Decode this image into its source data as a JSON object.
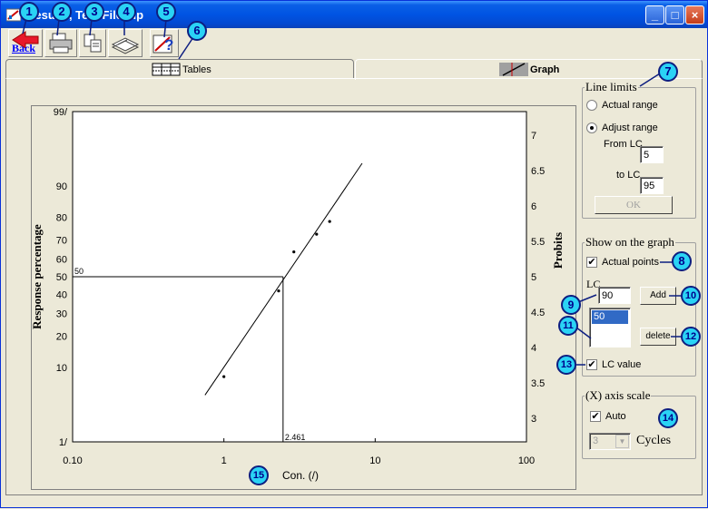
{
  "window": {
    "title": "Results, Test File.ldp",
    "minimize": "_",
    "maximize": "□",
    "close": "×"
  },
  "toolbar": {
    "back_label": "Back"
  },
  "tabs": [
    {
      "label": "Tables",
      "selected": false
    },
    {
      "label": "Graph",
      "selected": true
    }
  ],
  "callouts": {
    "m1": "1",
    "m2": "2",
    "m3": "3",
    "m4": "4",
    "m5": "5",
    "m6": "6",
    "m7": "7",
    "m8": "8",
    "m9": "9",
    "m10": "10",
    "m11": "11",
    "m12": "12",
    "m13": "13",
    "m14": "14",
    "m15": "15"
  },
  "line_limits": {
    "title": "Line limits",
    "actual_range": "Actual range",
    "adjust_range": "Adjust range",
    "selected": "adjust",
    "from_lc_label": "From LC",
    "from_lc_value": "5",
    "to_lc_label": "to LC",
    "to_lc_value": "95",
    "ok_label": "OK"
  },
  "show_on_graph": {
    "title": "Show on the graph",
    "actual_points_label": "Actual points",
    "actual_points_checked": true,
    "lc_label": "LC",
    "lc_input_value": "90",
    "add_label": "Add",
    "lc_list": [
      "50"
    ],
    "delete_label": "delete",
    "lc_value_label": "LC value",
    "lc_value_checked": true
  },
  "x_axis_scale": {
    "title": "(X) axis scale",
    "auto_label": "Auto",
    "auto_checked": true,
    "cycles_value": "3",
    "cycles_label": "Cycles"
  },
  "chart_data": {
    "type": "scatter",
    "xlabel": "Con. (/)",
    "ylabel": "Response percentage",
    "y2label": "Probits",
    "x_scale": "log",
    "xlim": [
      0.1,
      100
    ],
    "x_ticks": [
      "0.10",
      "1",
      "10",
      "100"
    ],
    "y_ticks_left": [
      {
        "label": "99/",
        "probit": 7.33
      },
      {
        "label": "90",
        "probit": 6.28
      },
      {
        "label": "80",
        "probit": 5.84
      },
      {
        "label": "70",
        "probit": 5.52
      },
      {
        "label": "60",
        "probit": 5.25
      },
      {
        "label": "50",
        "probit": 5.0
      },
      {
        "label": "40",
        "probit": 4.75
      },
      {
        "label": "30",
        "probit": 4.48
      },
      {
        "label": "20",
        "probit": 4.16
      },
      {
        "label": "10",
        "probit": 3.72
      },
      {
        "label": "1/",
        "probit": 2.67
      }
    ],
    "y_ticks_right": [
      "3",
      "3.5",
      "4",
      "4.5",
      "5",
      "5.5",
      "6",
      "6.5",
      "7"
    ],
    "ylim_probit": [
      2.67,
      7.33
    ],
    "points": [
      {
        "x": 1.0,
        "probit": 3.59
      },
      {
        "x": 2.3,
        "probit": 4.8
      },
      {
        "x": 2.9,
        "probit": 5.35
      },
      {
        "x": 4.1,
        "probit": 5.6
      },
      {
        "x": 5.0,
        "probit": 5.78
      }
    ],
    "fit_line": {
      "x": [
        0.75,
        8.2
      ],
      "probit": [
        3.33,
        6.6
      ]
    },
    "lc_marker": {
      "lc": "50",
      "x": 2.461,
      "x_label": "2.461",
      "y_label": "50",
      "probit": 5.0
    }
  }
}
